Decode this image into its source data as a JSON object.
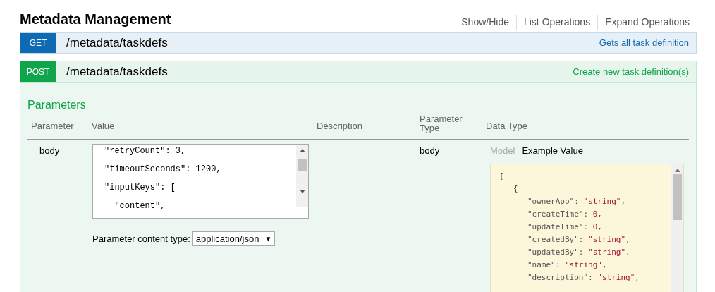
{
  "section": {
    "title": "Metadata Management",
    "actions": [
      "Show/Hide",
      "List Operations",
      "Expand Operations"
    ]
  },
  "operations": [
    {
      "method": "GET",
      "path": "/metadata/taskdefs",
      "summary": "Gets all task definition",
      "expanded": false
    },
    {
      "method": "POST",
      "path": "/metadata/taskdefs",
      "summary": "Create new task definition(s)",
      "expanded": true
    }
  ],
  "parameters": {
    "title": "Parameters",
    "columns": [
      "Parameter",
      "Value",
      "Description",
      "Parameter Type",
      "Data Type"
    ],
    "rows": [
      {
        "name": "body",
        "value_lines": [
          "\"retryCount\": 3,",
          "\"timeoutSeconds\": 1200,",
          "\"inputKeys\": [",
          "  \"content\","
        ],
        "content_type_label": "Parameter content type:",
        "content_type": "application/json",
        "content_type_caret": "▼",
        "parameter_type": "body",
        "data_type_tabs": [
          {
            "label": "Model",
            "selected": false
          },
          {
            "label": "Example Value",
            "selected": true
          }
        ],
        "example": [
          {
            "text": "[",
            "children": [
              {
                "text": "{",
                "children": [
                  {
                    "key": "\"ownerApp\":",
                    "value": "\"string\"",
                    "end": ","
                  },
                  {
                    "key": "\"createTime\":",
                    "value": "0",
                    "end": ","
                  },
                  {
                    "key": "\"updateTime\":",
                    "value": "0",
                    "end": ","
                  },
                  {
                    "key": "\"createdBy\":",
                    "value": "\"string\"",
                    "end": ","
                  },
                  {
                    "key": "\"updatedBy\":",
                    "value": "\"string\"",
                    "end": ","
                  },
                  {
                    "key": "\"name\":",
                    "value": "\"string\"",
                    "end": ","
                  },
                  {
                    "key": "\"description\":",
                    "value": "\"string\"",
                    "end": ","
                  }
                ]
              }
            ]
          }
        ]
      }
    ]
  }
}
